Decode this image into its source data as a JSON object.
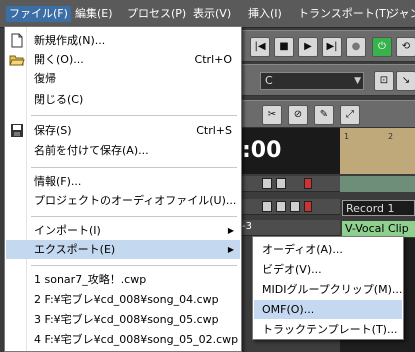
{
  "menubar": {
    "items": [
      "ファイル(F)",
      "編集(E)",
      "プロセス(P)",
      "表示(V)",
      "挿入(I)",
      "トランスポート(T)",
      "ジャン"
    ]
  },
  "file_menu": {
    "items": [
      {
        "label": "新規作成(N)...",
        "shortcut": "",
        "icon": "new-document-icon"
      },
      {
        "label": "開く(O)...",
        "shortcut": "Ctrl+O",
        "icon": "open-folder-icon"
      },
      {
        "label": "復帰",
        "shortcut": ""
      },
      {
        "label": "閉じる(C)",
        "shortcut": ""
      },
      {
        "label": "保存(S)",
        "shortcut": "Ctrl+S",
        "icon": "save-disk-icon"
      },
      {
        "label": "名前を付けて保存(A)...",
        "shortcut": ""
      },
      {
        "label": "情報(F)...",
        "shortcut": ""
      },
      {
        "label": "プロジェクトのオーディオファイル(U)...",
        "shortcut": ""
      },
      {
        "label": "インポート(I)",
        "shortcut": ""
      },
      {
        "label": "エクスポート(E)",
        "shortcut": ""
      },
      {
        "label": "1 sonar7_攻略！.cwp",
        "shortcut": ""
      },
      {
        "label": "2 F:¥宅ブレ¥cd_008¥song_04.cwp",
        "shortcut": ""
      },
      {
        "label": "3 F:¥宅ブレ¥cd_008¥song_05.cwp",
        "shortcut": ""
      },
      {
        "label": "4 F:¥宅ブレ¥cd_008¥song_05_02.cwp",
        "shortcut": ""
      }
    ]
  },
  "export_submenu": {
    "items": [
      {
        "label": "オーディオ(A)..."
      },
      {
        "label": "ビデオ(V)..."
      },
      {
        "label": "MIDIグループクリップ(M)..."
      },
      {
        "label": "OMF(O)..."
      },
      {
        "label": "トラックテンプレート(T)..."
      }
    ],
    "selected_index": 3
  },
  "background": {
    "key_value": "C",
    "time_display": ":00",
    "ruler_marks": [
      "1",
      "2"
    ],
    "track_number": "-3",
    "clips": [
      "Record 1",
      "V-Vocal Clip"
    ]
  },
  "colors": {
    "selection": "#c4d8ef",
    "menubar_active": "#3a6ea5",
    "clip_green": "#8ed08e"
  }
}
